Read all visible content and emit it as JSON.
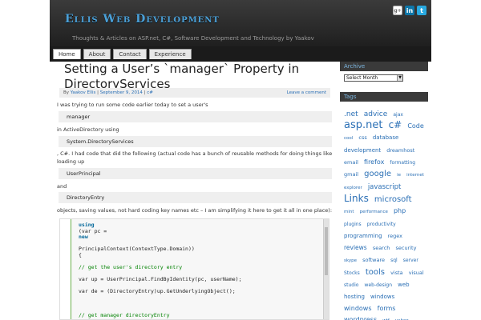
{
  "header": {
    "site_title": "Ellis Web Development",
    "tagline": "Thoughts & Articles on ASP.net, C#, Software Development and Technology by Yaakov"
  },
  "social": {
    "google": "g+",
    "linkedin": "in",
    "twitter": "t"
  },
  "nav": {
    "tabs": [
      "Home",
      "About",
      "Contact",
      "Experience"
    ]
  },
  "post": {
    "title": "Setting a User’s `manager` Property in DirectoryServices",
    "meta": {
      "by": "By",
      "author": "Yaakov Ellis",
      "sep1": "|",
      "date": "September 9, 2014",
      "sep2": "|",
      "category": "c#",
      "comment_link": "Leave a comment"
    },
    "p1": "I was trying to run some code earlier today to set a user's",
    "code1": "manager",
    "p2": "in ActiveDirectory using",
    "code2": "System.DirectoryServices",
    "p3": ", C#. I had code that did the following (actual code has a bunch of reusable methods for doing things like",
    "p4": "loading up",
    "code3": "UserPrincipal",
    "p5": "and",
    "code4": "DirectoryEntry",
    "p6": "objects, saving values, not hard coding key names etc – I am simplifying it here to get it all in one place):",
    "codeblock": {
      "l1_kw": "using",
      "l2": "(var pc =",
      "l3_kw": "new",
      "l4": "PrincipalContext(ContextType.Domain))",
      "l5": "{",
      "l6_cm": "// get the user's directory entry",
      "l7": "var up = UserPrincipal.FindByIdentity(pc, userName);",
      "l8": "var de = (DirectoryEntry)up.GetUnderlyingObject();",
      "l9_cm": "// get manager directoryEntry"
    }
  },
  "sidebar": {
    "archive_title": "Archive",
    "archive_select": "Select Month",
    "tags_title": "Tags",
    "tags": [
      {
        "t": ".net",
        "s": 9
      },
      {
        "t": "advice",
        "s": 9
      },
      {
        "t": "ajax",
        "s": 6
      },
      {
        "t": "asp.net",
        "s": 13
      },
      {
        "t": "c#",
        "s": 12
      },
      {
        "t": "Code",
        "s": 8
      },
      {
        "t": "cool",
        "s": 5.5
      },
      {
        "t": "css",
        "s": 6.5
      },
      {
        "t": "database",
        "s": 7
      },
      {
        "t": "development",
        "s": 7
      },
      {
        "t": "dreamhost",
        "s": 6.5
      },
      {
        "t": "email",
        "s": 6.5
      },
      {
        "t": "firefox",
        "s": 8
      },
      {
        "t": "formatting",
        "s": 6
      },
      {
        "t": "gmail",
        "s": 6.5
      },
      {
        "t": "google",
        "s": 10
      },
      {
        "t": "ie",
        "s": 5.5
      },
      {
        "t": "internet",
        "s": 5.5
      },
      {
        "t": "explorer",
        "s": 5.5
      },
      {
        "t": "javascript",
        "s": 8.5
      },
      {
        "t": "Links",
        "s": 12
      },
      {
        "t": "microsoft",
        "s": 10
      },
      {
        "t": "mint",
        "s": 5.5
      },
      {
        "t": "performance",
        "s": 5.5
      },
      {
        "t": "php",
        "s": 8
      },
      {
        "t": "plugins",
        "s": 6
      },
      {
        "t": "productivity",
        "s": 6
      },
      {
        "t": "programming",
        "s": 7
      },
      {
        "t": "regex",
        "s": 6.5
      },
      {
        "t": "reviews",
        "s": 7.5
      },
      {
        "t": "search",
        "s": 6.5
      },
      {
        "t": "security",
        "s": 6.5
      },
      {
        "t": "skype",
        "s": 5.5
      },
      {
        "t": "software",
        "s": 6.5
      },
      {
        "t": "sql",
        "s": 6
      },
      {
        "t": "server",
        "s": 6
      },
      {
        "t": "Stocks",
        "s": 6
      },
      {
        "t": "tools",
        "s": 10
      },
      {
        "t": "vista",
        "s": 6.5
      },
      {
        "t": "visual",
        "s": 6.5
      },
      {
        "t": "studio",
        "s": 6
      },
      {
        "t": "web-design",
        "s": 6
      },
      {
        "t": "web",
        "s": 7
      },
      {
        "t": "hosting",
        "s": 7
      },
      {
        "t": "windows",
        "s": 7
      },
      {
        "t": "windows",
        "s": 8
      },
      {
        "t": "forms",
        "s": 8
      },
      {
        "t": "wordpress",
        "s": 8
      },
      {
        "t": "wtf",
        "s": 5.5
      },
      {
        "t": "yahoo",
        "s": 5.5
      }
    ]
  }
}
